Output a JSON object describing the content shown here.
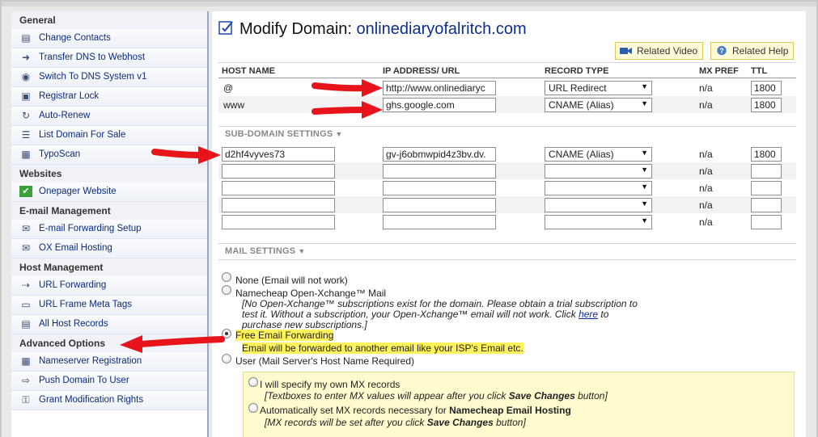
{
  "sidebar": {
    "sections": [
      {
        "title": "General",
        "items": [
          {
            "label": "Change Contacts",
            "icon": "contact-card-icon"
          },
          {
            "label": "Transfer DNS to Webhost",
            "icon": "transfer-arrow-icon"
          },
          {
            "label": "Switch To DNS System v1",
            "icon": "dns-switch-icon"
          },
          {
            "label": "Registrar Lock",
            "icon": "lock-icon"
          },
          {
            "label": "Auto-Renew",
            "icon": "renew-icon"
          },
          {
            "label": "List Domain For Sale",
            "icon": "list-sale-icon"
          },
          {
            "label": "TypoScan",
            "icon": "typoscan-icon"
          }
        ]
      },
      {
        "title": "Websites",
        "items": [
          {
            "label": "Onepager Website",
            "icon": "checkmark-icon"
          }
        ]
      },
      {
        "title": "E-mail Management",
        "items": [
          {
            "label": "E-mail Forwarding Setup",
            "icon": "email-forward-icon"
          },
          {
            "label": "OX Email Hosting",
            "icon": "envelope-icon"
          }
        ]
      },
      {
        "title": "Host Management",
        "items": [
          {
            "label": "URL Forwarding",
            "icon": "url-forward-icon"
          },
          {
            "label": "URL Frame Meta Tags",
            "icon": "frame-tag-icon"
          },
          {
            "label": "All Host Records",
            "icon": "host-records-icon"
          }
        ]
      },
      {
        "title": "Advanced Options",
        "items": [
          {
            "label": "Nameserver Registration",
            "icon": "nameserver-icon"
          },
          {
            "label": "Push Domain To User",
            "icon": "push-domain-icon"
          },
          {
            "label": "Grant Modification Rights",
            "icon": "grant-rights-icon"
          }
        ]
      }
    ]
  },
  "main": {
    "title_prefix": "Modify Domain:",
    "domain": "onlinediaryofalritch.com",
    "related_video": "Related Video",
    "related_help": "Related Help",
    "columns": [
      "HOST NAME",
      "IP ADDRESS/ URL",
      "RECORD TYPE",
      "MX PREF",
      "TTL"
    ],
    "host_records": [
      {
        "host": "@",
        "address": "http://www.onlinediaryc",
        "type": "URL Redirect",
        "mx": "n/a",
        "ttl": "1800"
      },
      {
        "host": "www",
        "address": "ghs.google.com",
        "type": "CNAME (Alias)",
        "mx": "n/a",
        "ttl": "1800"
      }
    ],
    "subdomain_label": "SUB-DOMAIN SETTINGS",
    "subdomain_records": [
      {
        "host": "d2hf4vyves73",
        "address": "gv-j6obmwpid4z3bv.dv.",
        "type": "CNAME (Alias)",
        "mx": "n/a",
        "ttl": "1800"
      },
      {
        "host": "",
        "address": "",
        "type": "",
        "mx": "n/a",
        "ttl": ""
      },
      {
        "host": "",
        "address": "",
        "type": "",
        "mx": "n/a",
        "ttl": ""
      },
      {
        "host": "",
        "address": "",
        "type": "",
        "mx": "n/a",
        "ttl": ""
      },
      {
        "host": "",
        "address": "",
        "type": "",
        "mx": "n/a",
        "ttl": ""
      }
    ],
    "mail_label": "MAIL SETTINGS",
    "mail": {
      "none": "None (Email will not work)",
      "ox": "Namecheap Open-Xchange™ Mail",
      "ox_note_1": "[No Open-Xchange™ subscriptions exist for the domain. Please obtain a trial subscription to",
      "ox_note_2a": "test it. Without a subscription, your Open-Xchange™ email will not work. Click ",
      "ox_note_link": "here",
      "ox_note_2b": " to",
      "ox_note_3": "purchase new subscriptions.]",
      "free": "Free Email Forwarding",
      "free_note": "Email will be forwarded to another email like your ISP's Email etc.",
      "user": "User (Mail Server's Host Name Required)",
      "mx_own": "I will specify my own MX records",
      "mx_own_note_a": "[Textboxes to enter MX values will appear after you click ",
      "mx_own_note_b": "Save Changes",
      "mx_own_note_c": " button]",
      "mx_auto_a": "Automatically set MX records necessary for ",
      "mx_auto_b": "Namecheap Email Hosting",
      "mx_auto_note_a": "[MX records will be set after you click ",
      "mx_auto_note_b": "Save Changes",
      "mx_auto_note_c": " button]",
      "selected": "free"
    }
  },
  "colors": {
    "link": "#0a2b7d",
    "highlight": "#fff35c",
    "arrow": "#e8141b",
    "mx_box": "#fffbcf"
  }
}
